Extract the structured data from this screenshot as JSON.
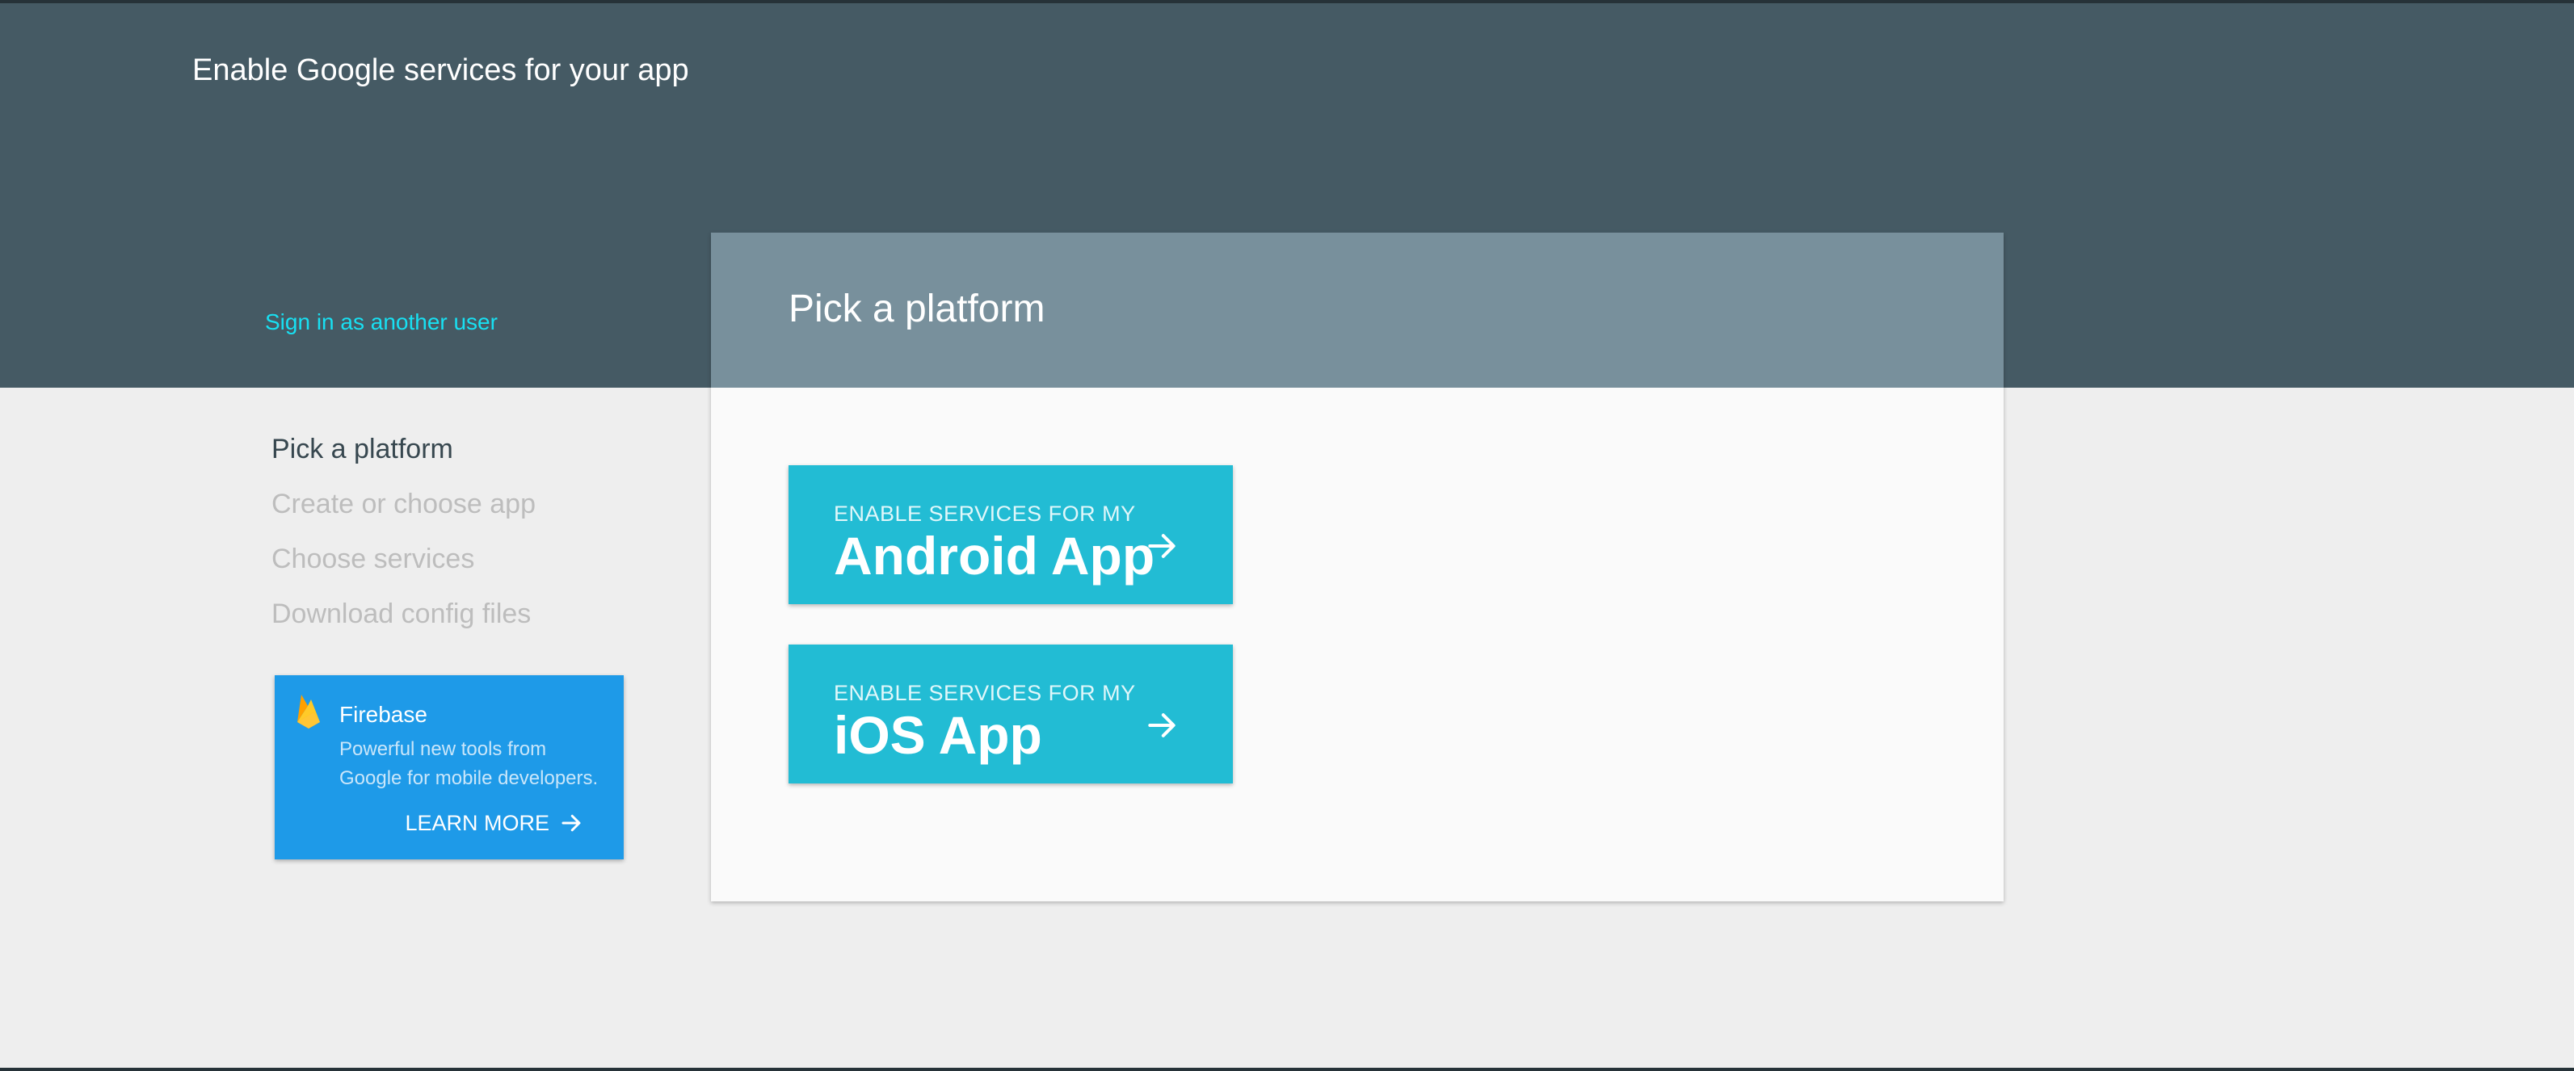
{
  "header": {
    "title": "Enable Google services for your app",
    "signin_link": "Sign in as another user"
  },
  "steps": [
    {
      "label": "Pick a platform",
      "active": true
    },
    {
      "label": "Create or choose app",
      "active": false
    },
    {
      "label": "Choose services",
      "active": false
    },
    {
      "label": "Download config files",
      "active": false
    }
  ],
  "firebase_card": {
    "icon": "firebase-flame-icon",
    "title": "Firebase",
    "description": "Powerful new tools from Google for mobile developers.",
    "action": "LEARN MORE",
    "action_icon": "arrow-right-icon"
  },
  "panel": {
    "title": "Pick a platform",
    "buttons": [
      {
        "small": "ENABLE SERVICES FOR MY",
        "big": "Android App",
        "icon": "arrow-right-icon"
      },
      {
        "small": "ENABLE SERVICES FOR MY",
        "big": "iOS App",
        "icon": "arrow-right-icon"
      }
    ]
  },
  "colors": {
    "header_bg": "#455a64",
    "panel_header_bg": "#78909c",
    "link": "#18e0f2",
    "button_bg": "#22bcd4",
    "card_bg": "#1e9ae8",
    "page_bg": "#eeeeee"
  }
}
